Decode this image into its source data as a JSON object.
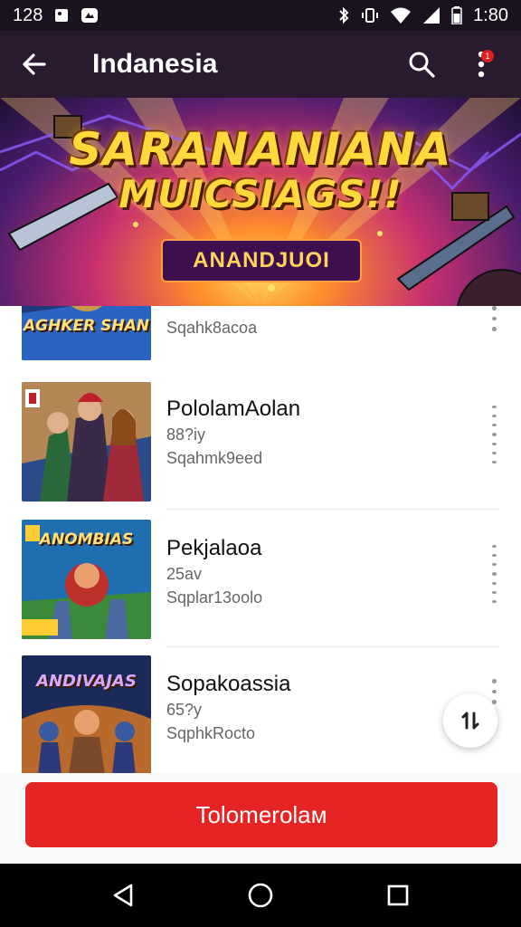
{
  "status_bar": {
    "time_left": "128",
    "time_right": "1:80",
    "icons_left": [
      "image-icon",
      "app-notification-icon"
    ],
    "icons_right": [
      "bluetooth-icon",
      "vibrate-icon",
      "wifi-icon",
      "signal-icon",
      "battery-icon"
    ]
  },
  "app_bar": {
    "title": "Indanesia",
    "notification_badge": "1"
  },
  "banner": {
    "title_line1": "SARANANIANA",
    "title_line2": "MUICSIAGS!!",
    "cta_label": "ANANDJUOI"
  },
  "list": {
    "items": [
      {
        "title": "",
        "meta": "",
        "sub": "Sqahk8acoa",
        "thumb_label": "AGHKER SHAN"
      },
      {
        "title": "PololamAolan",
        "meta": "88?iy",
        "sub": "Sqahmk9eed",
        "thumb_label": ""
      },
      {
        "title": "Pekjalaoa",
        "meta": "25av",
        "sub": "Sqplar13oolo",
        "thumb_label": "ANOMBIAS"
      },
      {
        "title": "Sopakoassia",
        "meta": "65?y",
        "sub": "SqphkRocto",
        "thumb_label": "ANDIVAJAS"
      }
    ]
  },
  "primary_button": {
    "label": "Tolomerolaм"
  },
  "colors": {
    "status_bg": "#1b1220",
    "app_bar_bg": "#2a1a30",
    "accent_red": "#e62424",
    "banner_title": "#ffd93b"
  }
}
